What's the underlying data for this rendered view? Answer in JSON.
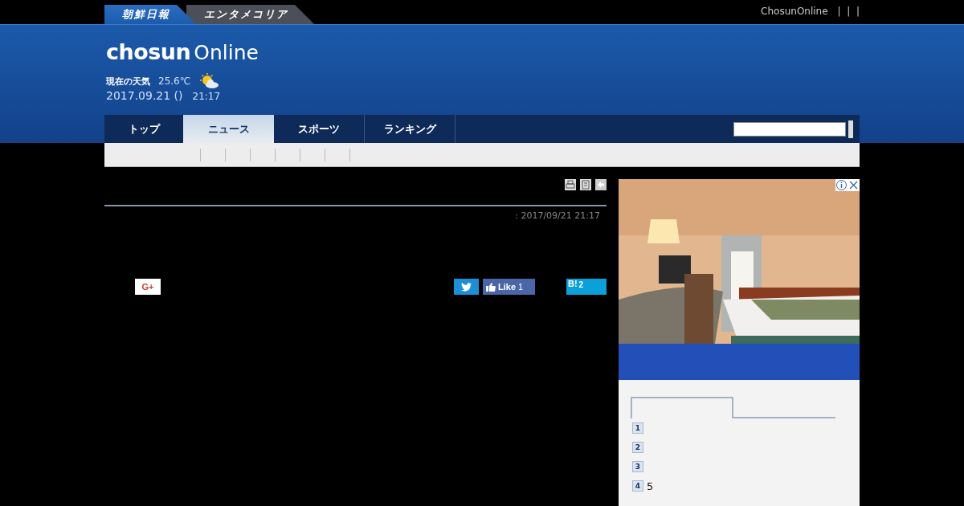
{
  "top_tabs": [
    {
      "label": "朝鮮日報",
      "selected": true
    },
    {
      "label": "エンタメコリア",
      "selected": false
    }
  ],
  "top_links": {
    "site": "ChosunOnline",
    "separators": "|  |  |"
  },
  "logo": {
    "main": "chosun",
    "sub": "Online"
  },
  "weather": {
    "label": "現在の天気",
    "temperature": "25.6℃"
  },
  "date": "2017.09.21 ()",
  "time": "21:17",
  "nav": [
    {
      "label": "トップ",
      "selected": false
    },
    {
      "label": "ニュース",
      "selected": true
    },
    {
      "label": "スポーツ",
      "selected": false
    },
    {
      "label": "ランキング",
      "selected": false
    }
  ],
  "article": {
    "timestamp": ": 2017/09/21 21:17"
  },
  "share": {
    "gplus": "G+",
    "facebook": "Like",
    "facebook_count": "1",
    "hatena": "B!",
    "hatena_count": "2"
  },
  "ranking": [
    {
      "rank": "1"
    },
    {
      "rank": "2"
    },
    {
      "rank": "3"
    },
    {
      "rank": "4",
      "title": "5"
    }
  ]
}
